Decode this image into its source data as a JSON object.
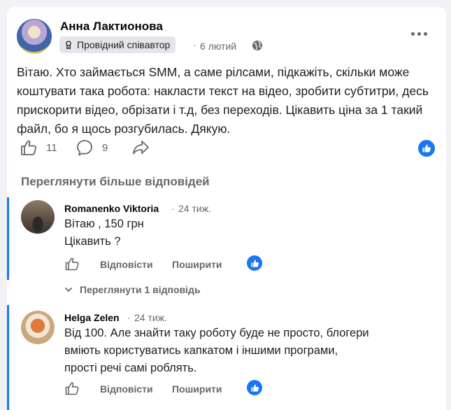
{
  "post": {
    "author": "Анна Лактионова",
    "badge": "Провідний співавтор",
    "separator": "·",
    "date": "6 лютий",
    "text": "Вітаю. Хто займається SMM, а саме рілсами, підкажіть, скільки може коштувати така робота: накласти текст на відео, зробити субтитри, десь прискорити відео, обрізати і т.д, без переходів. Цікавить ціна за 1 такий файл, бо я щось розгубилась. Дякую.",
    "likes": "11",
    "comments": "9"
  },
  "more_replies_label": "Переглянути більше відповідей",
  "comments": [
    {
      "author": "Romanenko Viktoria",
      "separator": "·",
      "time": "24 тиж.",
      "line1": "Вітаю , 150 грн",
      "line2": "Цікавить ?",
      "reply_label": "Відповісти",
      "share_label": "Поширити"
    },
    {
      "author": "Helga Zelen",
      "separator": "·",
      "time": "24 тиж.",
      "line1": "Від 100. Але знайти таку роботу буде не просто, блогери",
      "line2": "вміють користуватись капкатом і іншими програми,",
      "line3": "прості речі самі роблять.",
      "reply_label": "Відповісти",
      "share_label": "Поширити"
    }
  ],
  "view_replies_label": "Переглянути 1 відповідь",
  "colors": {
    "accent": "#1877f2",
    "muted": "#65676b",
    "background": "#f0f2f5"
  }
}
